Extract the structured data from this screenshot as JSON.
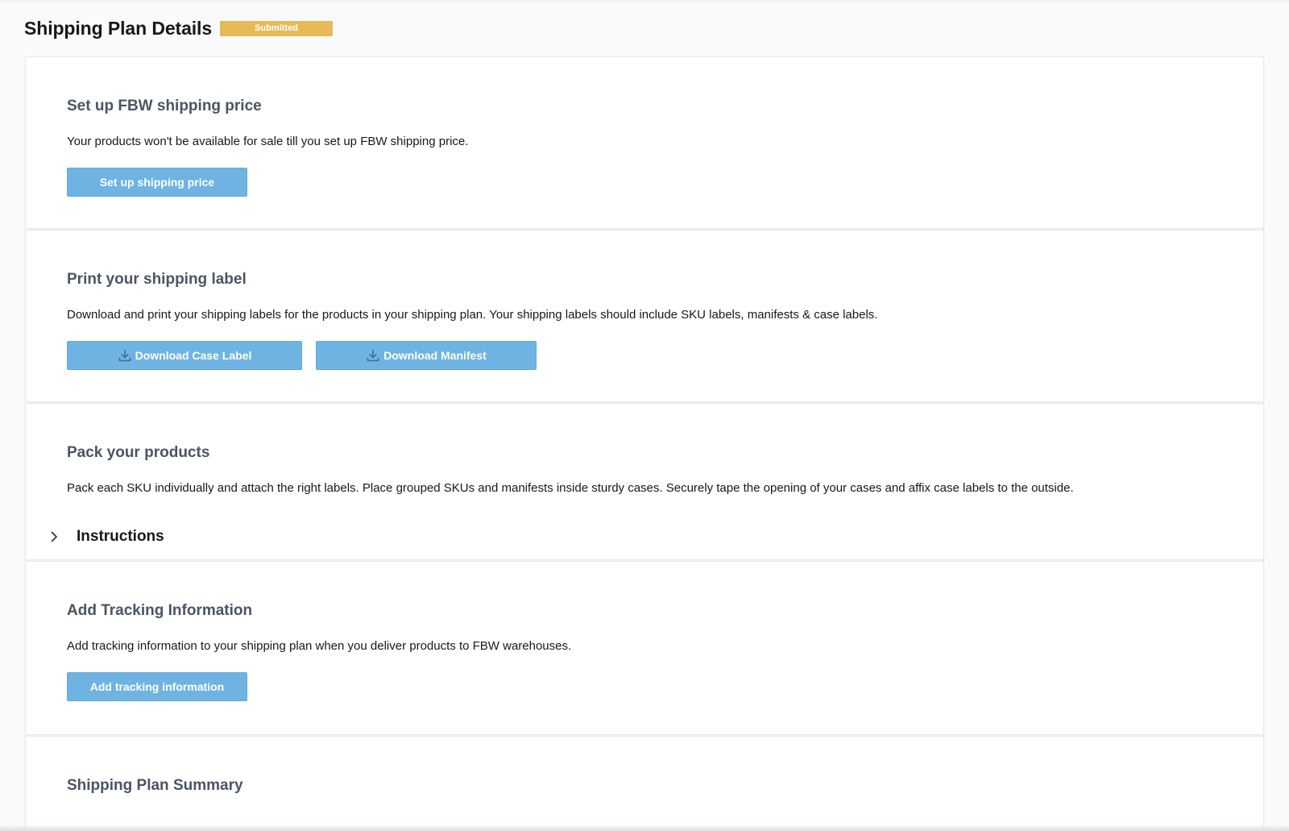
{
  "header": {
    "title": "Shipping Plan Details",
    "status": "Submitted"
  },
  "colors": {
    "status_badge": "#e8b957",
    "button": "#6fb3e2",
    "section_title": "#4a5563",
    "background": "#f9fafb"
  },
  "sections": [
    {
      "title": "Set up FBW shipping price",
      "description": "Your products won't be available for sale till you set up FBW shipping price.",
      "buttons": [
        {
          "label": "Set up shipping price",
          "icon": ""
        }
      ]
    },
    {
      "title": "Print your shipping label",
      "description": "Download and print your shipping labels for the products in your shipping plan. Your shipping labels should include SKU labels, manifests & case labels.",
      "buttons": [
        {
          "label": "Download Case Label",
          "icon": "download-icon"
        },
        {
          "label": "Download Manifest",
          "icon": "download-icon"
        }
      ]
    },
    {
      "title": "Pack your products",
      "description": "Pack each SKU individually and attach the right labels. Place grouped SKUs and manifests inside sturdy cases. Securely tape the opening of your cases and affix case labels to the outside.",
      "expander": {
        "label": "Instructions",
        "icon": "chevron-right-icon",
        "expanded": false
      }
    },
    {
      "title": "Add Tracking Information",
      "description": "Add tracking information to your shipping plan when you deliver products to FBW warehouses.",
      "buttons": [
        {
          "label": "Add tracking information",
          "icon": ""
        }
      ]
    },
    {
      "title": "Shipping Plan Summary"
    }
  ]
}
